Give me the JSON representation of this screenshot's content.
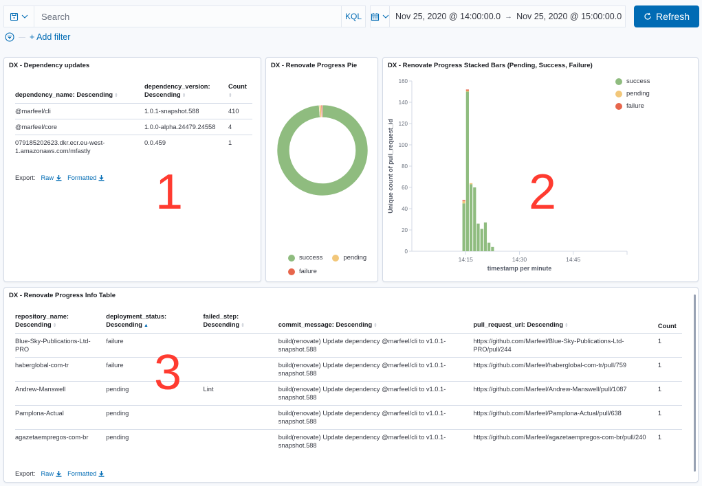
{
  "query_bar": {
    "saved_query_icon": "save-icon",
    "search_placeholder": "Search",
    "search_value": "",
    "language_toggle": "KQL",
    "date_icon": "calendar-icon",
    "date_start": "Nov 25, 2020 @ 14:00:00.0",
    "date_arrow": "→",
    "date_end": "Nov 25, 2020 @ 15:00:00.0",
    "refresh_label": "Refresh",
    "add_filter_label": "+ Add filter"
  },
  "colors": {
    "accent": "#006bb4",
    "success": "#8fbc7f",
    "pending": "#f2c77a",
    "failure": "#e7664c",
    "annotation": "#ff3b30"
  },
  "dependency_panel": {
    "title": "DX - Dependency updates",
    "columns": [
      {
        "label_line1": "dependency_name: Descending",
        "label_line2": ""
      },
      {
        "label_line1": "dependency_version:",
        "label_line2": "Descending"
      },
      {
        "label_line1": "Count",
        "label_line2": ""
      }
    ],
    "rows": [
      {
        "name": "@marfeel/cli",
        "version": "1.0.1-snapshot.588",
        "count": "410"
      },
      {
        "name": "@marfeel/core",
        "version": "1.0.0-alpha.24479.24558",
        "count": "4"
      },
      {
        "name": "079185202623.dkr.ecr.eu-west-1.amazonaws.com/mfastly",
        "version": "0.0.459",
        "count": "1"
      }
    ],
    "export_label": "Export:",
    "export_raw": "Raw",
    "export_formatted": "Formatted",
    "annotation": "1"
  },
  "pie_panel": {
    "title": "DX - Renovate Progress Pie",
    "legend": [
      {
        "label": "success",
        "color": "#8fbc7f"
      },
      {
        "label": "pending",
        "color": "#f2c77a"
      },
      {
        "label": "failure",
        "color": "#e7664c"
      }
    ]
  },
  "bars_panel": {
    "title": "DX - Renovate Progress Stacked Bars (Pending, Success, Failure)",
    "annotation": "2",
    "legend": [
      {
        "label": "success",
        "color": "#8fbc7f"
      },
      {
        "label": "pending",
        "color": "#f2c77a"
      },
      {
        "label": "failure",
        "color": "#e7664c"
      }
    ]
  },
  "info_panel": {
    "title": "DX - Renovate Progress Info Table",
    "annotation": "3",
    "columns": [
      {
        "l1": "repository_name:",
        "l2": "Descending",
        "active": false
      },
      {
        "l1": "deployment_status:",
        "l2": "Descending",
        "active": true
      },
      {
        "l1": "failed_step:",
        "l2": "Descending",
        "active": false
      },
      {
        "l1": "",
        "l2": "commit_message: Descending",
        "active": false
      },
      {
        "l1": "",
        "l2": "pull_request_url: Descending",
        "active": false
      },
      {
        "l1": "Count",
        "l2": "",
        "active": false
      }
    ],
    "rows": [
      {
        "repo": "Blue-Sky-Publications-Ltd-PRO",
        "status": "failure",
        "step": "",
        "commit": "build(renovate) Update dependency @marfeel/cli to v1.0.1-snapshot.588",
        "url": "https://github.com/Marfeel/Blue-Sky-Publications-Ltd-PRO/pull/244",
        "count": "1"
      },
      {
        "repo": "haberglobal-com-tr",
        "status": "failure",
        "step": "",
        "commit": "build(renovate) Update dependency @marfeel/cli to v1.0.1-snapshot.588",
        "url": "https://github.com/Marfeel/haberglobal-com-tr/pull/759",
        "count": "1"
      },
      {
        "repo": "Andrew-Manswell",
        "status": "pending",
        "step": "Lint",
        "commit": "build(renovate) Update dependency @marfeel/cli to v1.0.1-snapshot.588",
        "url": "https://github.com/Marfeel/Andrew-Manswell/pull/1087",
        "count": "1"
      },
      {
        "repo": "Pamplona-Actual",
        "status": "pending",
        "step": "",
        "commit": "build(renovate) Update dependency @marfeel/cli to v1.0.1-snapshot.588",
        "url": "https://github.com/Marfeel/Pamplona-Actual/pull/638",
        "count": "1"
      },
      {
        "repo": "agazetaempregos-com-br",
        "status": "pending",
        "step": "",
        "commit": "build(renovate) Update dependency @marfeel/cli to v1.0.1-snapshot.588",
        "url": "https://github.com/Marfeel/agazetaempregos-com-br/pull/240",
        "count": "1"
      }
    ],
    "export_label": "Export:",
    "export_raw": "Raw",
    "export_formatted": "Formatted"
  },
  "chart_data": [
    {
      "type": "pie",
      "title": "DX - Renovate Progress Pie",
      "donut": true,
      "labels": [
        "success",
        "pending",
        "failure"
      ],
      "values": [
        410,
        3,
        2
      ],
      "colors": [
        "#8fbc7f",
        "#f2c77a",
        "#e7664c"
      ],
      "legend": "bottom"
    },
    {
      "type": "bar",
      "stacked": true,
      "title": "DX - Renovate Progress Stacked Bars (Pending, Success, Failure)",
      "xlabel": "timestamp per minute",
      "ylabel": "Unique count of pull_request_id",
      "x_domain_minutes": [
        0,
        60
      ],
      "x_ticks": [
        {
          "minute": 15,
          "label": "14:15"
        },
        {
          "minute": 30,
          "label": "14:30"
        },
        {
          "minute": 45,
          "label": "14:45"
        }
      ],
      "y_ticks": [
        0,
        20,
        40,
        60,
        80,
        100,
        120,
        140,
        160
      ],
      "ylim": [
        0,
        160
      ],
      "x_minutes": [
        14,
        15,
        16,
        17,
        18,
        19,
        20,
        21,
        22
      ],
      "categories": [
        "14:14",
        "14:15",
        "14:16",
        "14:17",
        "14:18",
        "14:19",
        "14:20",
        "14:21",
        "14:22"
      ],
      "series": [
        {
          "name": "success",
          "color": "#8fbc7f",
          "values": [
            45,
            150,
            63,
            60,
            26,
            21,
            27,
            8,
            4
          ]
        },
        {
          "name": "pending",
          "color": "#f2c77a",
          "values": [
            2,
            1,
            1,
            0,
            0,
            0,
            0,
            0,
            0
          ]
        },
        {
          "name": "failure",
          "color": "#e7664c",
          "values": [
            1,
            1,
            0,
            0,
            0,
            0,
            0,
            0,
            0
          ]
        }
      ],
      "legend": "top-right",
      "grid": false
    }
  ]
}
